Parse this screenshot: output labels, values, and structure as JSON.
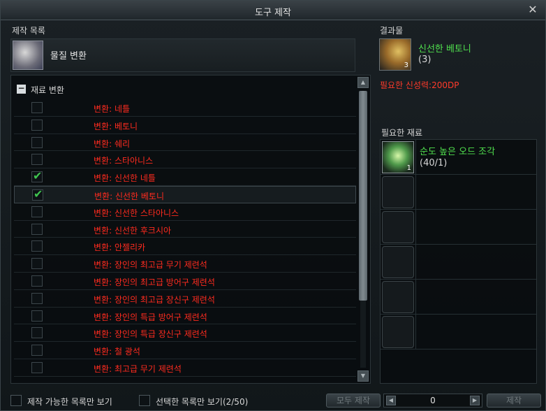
{
  "window": {
    "title": "도구 제작",
    "close_glyph": "✕"
  },
  "craft_list": {
    "heading": "제작 목록",
    "category": {
      "name": "물질 변환",
      "icon": "hand-transform-icon"
    },
    "group": {
      "label": "재료 변환",
      "toggle": "−"
    },
    "items": [
      {
        "label": "변환: 네틀",
        "checked": false
      },
      {
        "label": "변환: 베토니",
        "checked": false
      },
      {
        "label": "변환: 쉐리",
        "checked": false
      },
      {
        "label": "변환: 스타아니스",
        "checked": false
      },
      {
        "label": "변환: 신선한 네틀",
        "checked": true
      },
      {
        "label": "변환: 신선한 베토니",
        "checked": true,
        "selected": true
      },
      {
        "label": "변환: 신선한 스타아니스",
        "checked": false
      },
      {
        "label": "변환: 신선한 후크시아",
        "checked": false
      },
      {
        "label": "변환: 안젤리카",
        "checked": false
      },
      {
        "label": "변환: 장인의 최고급 무기 제련석",
        "checked": false
      },
      {
        "label": "변환: 장인의 최고급 방어구 제련석",
        "checked": false
      },
      {
        "label": "변환: 장인의 최고급 장신구 제련석",
        "checked": false
      },
      {
        "label": "변환: 장인의 특급 방어구 제련석",
        "checked": false
      },
      {
        "label": "변환: 장인의 특급 장신구 제련석",
        "checked": false
      },
      {
        "label": "변환: 철 광석",
        "checked": false
      },
      {
        "label": "변환: 최고급 무기 제련석",
        "checked": false
      }
    ],
    "check_glyph": "✔"
  },
  "result": {
    "heading": "결과물",
    "name": "신선한 베토니",
    "count": "(3)",
    "slot_qty": "3",
    "icon": "herb-icon"
  },
  "requirement": {
    "divine_power": "필요한 신성력:200DP"
  },
  "materials": {
    "heading": "필요한 재료",
    "items": [
      {
        "name": "순도 높은 오드 조각",
        "count": "(40/1)",
        "slot_qty": "1",
        "icon": "odd-fragment-icon"
      }
    ]
  },
  "footer": {
    "craftable_only": "제작 가능한 목록만 보기",
    "selected_only": "선택한 목록만 보기(2/50)",
    "craft_all": "모두 제작",
    "quantity": "0",
    "craft": "제작",
    "left_arrow": "◀",
    "right_arrow": "▶"
  },
  "colors": {
    "item_red": "#ff2b1f",
    "item_green": "#50e04e",
    "check_green": "#3fc44f"
  }
}
